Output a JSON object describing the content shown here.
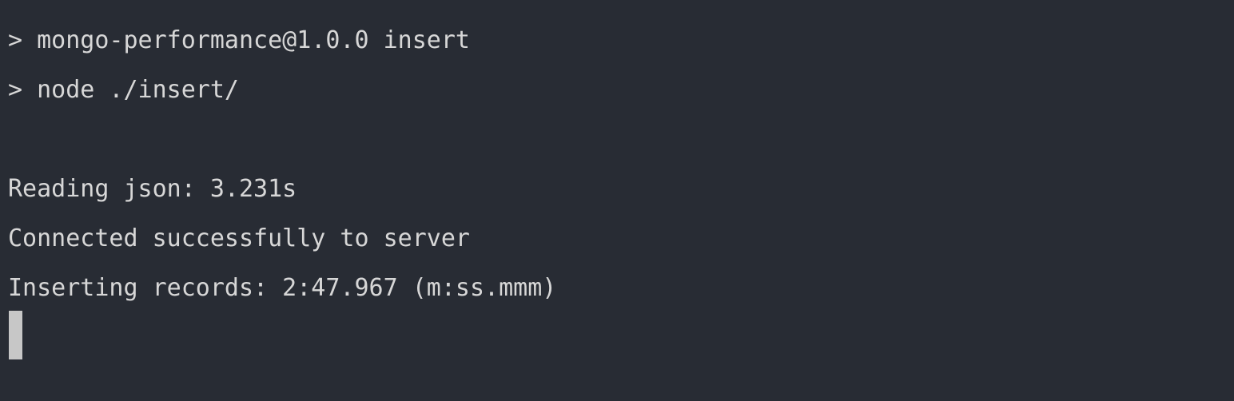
{
  "terminal": {
    "lines": [
      "> mongo-performance@1.0.0 insert",
      "> node ./insert/",
      "Reading json: 3.231s",
      "Connected successfully to server",
      "Inserting records: 2:47.967 (m:ss.mmm)"
    ]
  }
}
